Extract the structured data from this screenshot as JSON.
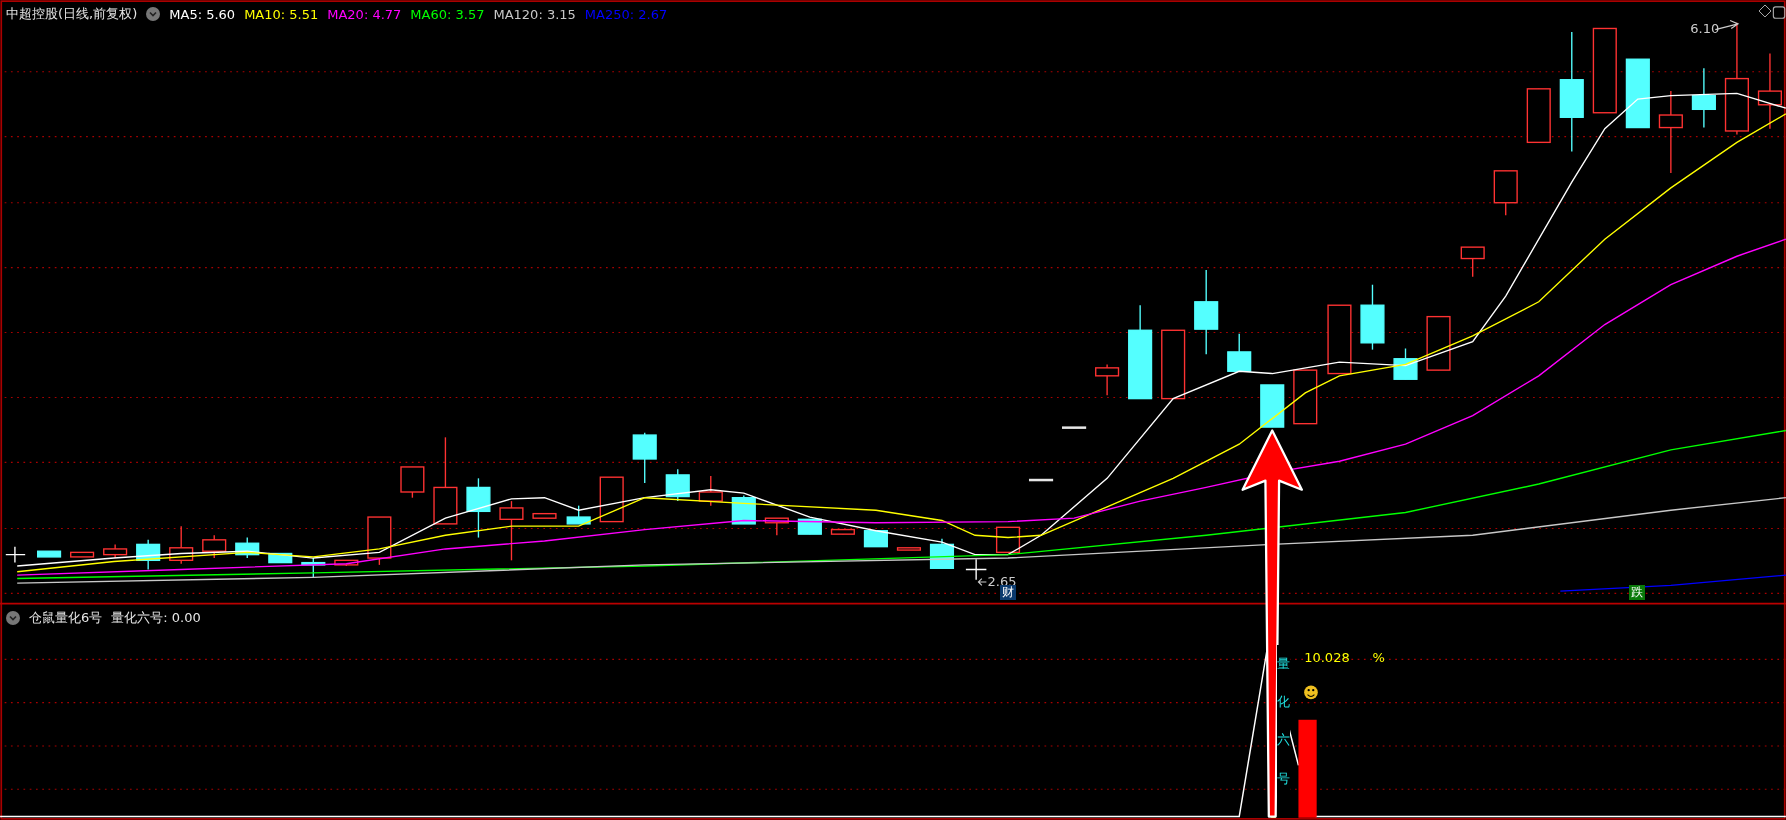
{
  "header": {
    "title": "中超控股(日线,前复权)",
    "ma": [
      {
        "label": "MA5: 5.60",
        "color": "#ffffff"
      },
      {
        "label": "MA10: 5.51",
        "color": "#ffff00"
      },
      {
        "label": "MA20: 4.77",
        "color": "#ff00ff"
      },
      {
        "label": "MA60: 3.57",
        "color": "#00ff00"
      },
      {
        "label": "MA120: 3.15",
        "color": "#c8c8c8"
      },
      {
        "label": "MA250: 2.67",
        "color": "#0000ff"
      }
    ]
  },
  "price_chart": {
    "high_label": "6.10",
    "low_label": "2.65",
    "markers": [
      {
        "text": "财",
        "color": "#0a3a6e"
      },
      {
        "text": "跌",
        "color": "#0a7a0a"
      }
    ]
  },
  "indicator_panel": {
    "name": "仓鼠量化6号",
    "value": "量化六号: 0.00",
    "vertical_text": "量化六号",
    "reading": "10.028",
    "unit": "%"
  }
}
